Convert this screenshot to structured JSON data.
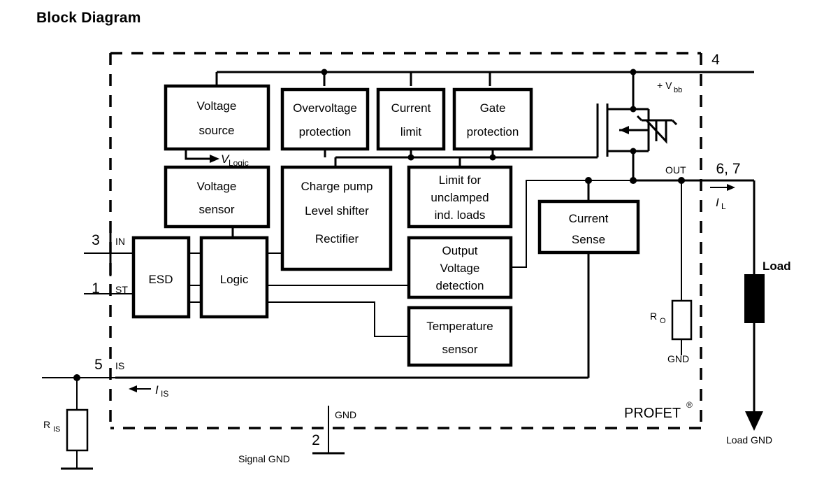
{
  "page": {
    "title": "Block Diagram"
  },
  "blocks": [
    {
      "id": "voltage-source",
      "lines": [
        "Voltage",
        "source"
      ]
    },
    {
      "id": "overvoltage-protection",
      "lines": [
        "Overvoltage",
        "protection"
      ]
    },
    {
      "id": "current-limit",
      "lines": [
        "Current",
        "limit"
      ]
    },
    {
      "id": "gate-protection",
      "lines": [
        "Gate",
        "protection"
      ]
    },
    {
      "id": "voltage-sensor",
      "lines": [
        "Voltage",
        "sensor"
      ]
    },
    {
      "id": "charge-pump",
      "lines": [
        "Charge pump",
        "Level shifter",
        "Rectifier"
      ]
    },
    {
      "id": "limit-unclamped",
      "lines": [
        "Limit for",
        "unclamped",
        "ind. loads"
      ]
    },
    {
      "id": "esd",
      "lines": [
        "ESD"
      ]
    },
    {
      "id": "logic",
      "lines": [
        "Logic"
      ]
    },
    {
      "id": "output-voltage-detection",
      "lines": [
        "Output",
        "Voltage",
        "detection"
      ]
    },
    {
      "id": "temperature-sensor",
      "lines": [
        "Temperature",
        "sensor"
      ]
    },
    {
      "id": "current-sense",
      "lines": [
        "Current",
        "Sense"
      ]
    }
  ],
  "block_text": {
    "voltage_source_1": "Voltage",
    "voltage_source_2": "source",
    "overvoltage_1": "Overvoltage",
    "overvoltage_2": "protection",
    "current_limit_1": "Current",
    "current_limit_2": "limit",
    "gate_protection_1": "Gate",
    "gate_protection_2": "protection",
    "voltage_sensor_1": "Voltage",
    "voltage_sensor_2": "sensor",
    "charge_pump_1": "Charge pump",
    "charge_pump_2": "Level shifter",
    "charge_pump_3": "Rectifier",
    "limit_1": "Limit for",
    "limit_2": "unclamped",
    "limit_3": "ind. loads",
    "esd": "ESD",
    "logic": "Logic",
    "output_volt_1": "Output",
    "output_volt_2": "Voltage",
    "output_volt_3": "detection",
    "temp_1": "Temperature",
    "temp_2": "sensor",
    "current_sense_1": "Current",
    "current_sense_2": "Sense"
  },
  "pins": [
    {
      "number": "4",
      "name": "+ V",
      "sub": "bb"
    },
    {
      "number": "3",
      "name": "IN",
      "sub": ""
    },
    {
      "number": "1",
      "name": "ST",
      "sub": ""
    },
    {
      "number": "5",
      "name": "IS",
      "sub": ""
    },
    {
      "number": "2",
      "name": "GND",
      "sub": ""
    },
    {
      "number": "6, 7",
      "name": "OUT",
      "sub": ""
    }
  ],
  "pin_labels": {
    "p4_num": "4",
    "p3_num": "3",
    "p3_name": "IN",
    "p1_num": "1",
    "p1_name": "ST",
    "p5_num": "5",
    "p5_name": "IS",
    "p2_num": "2",
    "p2_name": "GND",
    "p67_num": "6, 7",
    "p67_name": "OUT"
  },
  "annotations": {
    "vbb_main": "+ V",
    "vbb_sub": "bb",
    "vlogic_main": "V",
    "vlogic_sub": "Logic",
    "il_main": "I",
    "il_sub": "L",
    "iis_main": "I",
    "iis_sub": "IS",
    "ro_main": "R",
    "ro_sub": "O",
    "ris_main": "R",
    "ris_sub": "IS",
    "gnd_ro": "GND",
    "signal_gnd": "Signal GND",
    "load": "Load",
    "load_gnd": "Load GND",
    "profet": "PROFET",
    "profet_reg": "®"
  },
  "colors": {
    "stroke": "#000000",
    "background": "#ffffff"
  }
}
